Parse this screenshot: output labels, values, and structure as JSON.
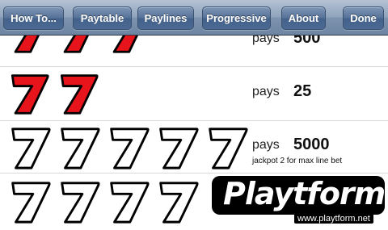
{
  "toolbar": {
    "buttons": [
      {
        "label": "How To..."
      },
      {
        "label": "Paytable"
      },
      {
        "label": "Paylines"
      },
      {
        "label": "Progressive"
      },
      {
        "label": "About"
      },
      {
        "label": "Done"
      }
    ]
  },
  "paytable": {
    "rows": [
      {
        "symbol": "red-seven",
        "count": 3,
        "pays_label": "pays",
        "amount": "500",
        "note": ""
      },
      {
        "symbol": "red-seven",
        "count": 2,
        "pays_label": "pays",
        "amount": "25",
        "note": ""
      },
      {
        "symbol": "white-seven",
        "count": 5,
        "pays_label": "pays",
        "amount": "5000",
        "note": "jackpot 2 for max line bet"
      },
      {
        "symbol": "white-seven",
        "count": 4,
        "pays_label": "pays",
        "amount": "",
        "note": ""
      }
    ]
  },
  "watermark": {
    "brand": "Playtform",
    "url": "www.playtform.net"
  },
  "colors": {
    "red_seven": "#e8141b",
    "toolbar_top": "#b4c2d3",
    "toolbar_bottom": "#6d85a3",
    "button": "#4b6a93"
  }
}
